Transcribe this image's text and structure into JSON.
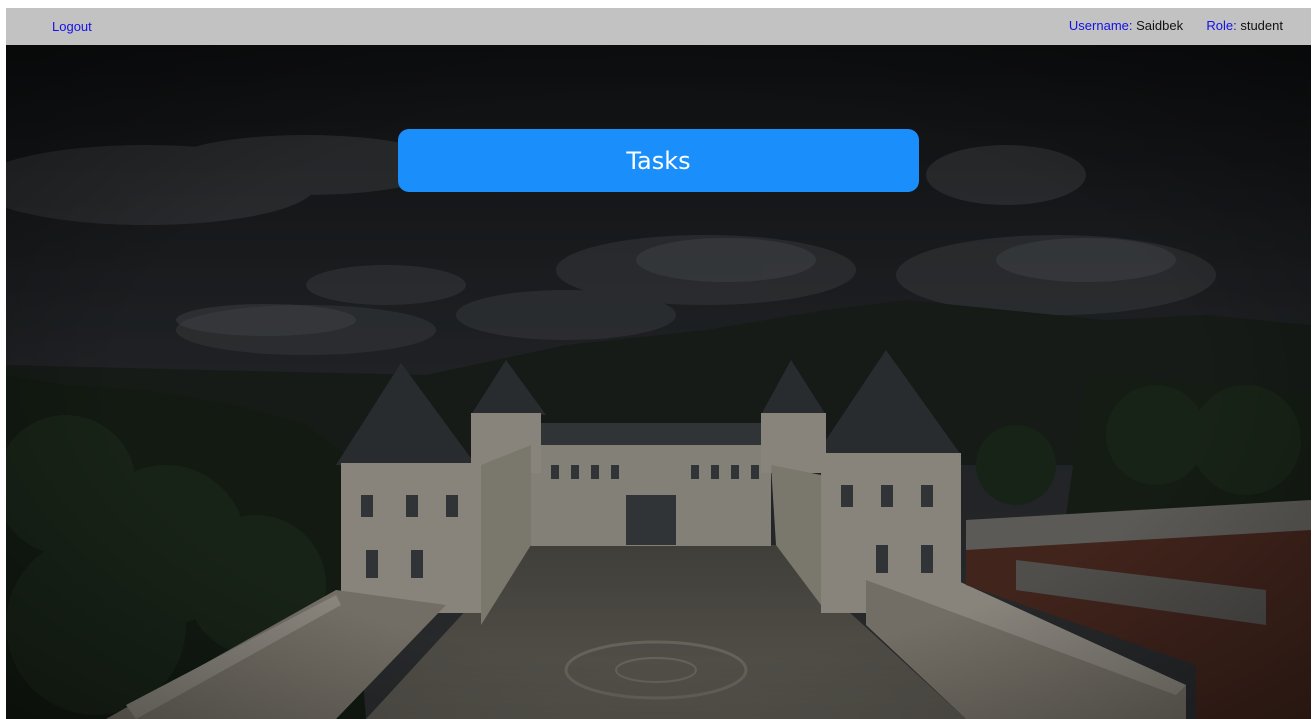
{
  "topbar": {
    "logout_label": "Logout",
    "username_label": "Username:",
    "username_value": "Saidbek",
    "role_label": "Role:",
    "role_value": "student"
  },
  "main": {
    "tasks_button_label": "Tasks"
  },
  "colors": {
    "topbar_bg": "#c2c2c2",
    "link": "#1410e6",
    "primary_button": "#1a8ffc"
  }
}
